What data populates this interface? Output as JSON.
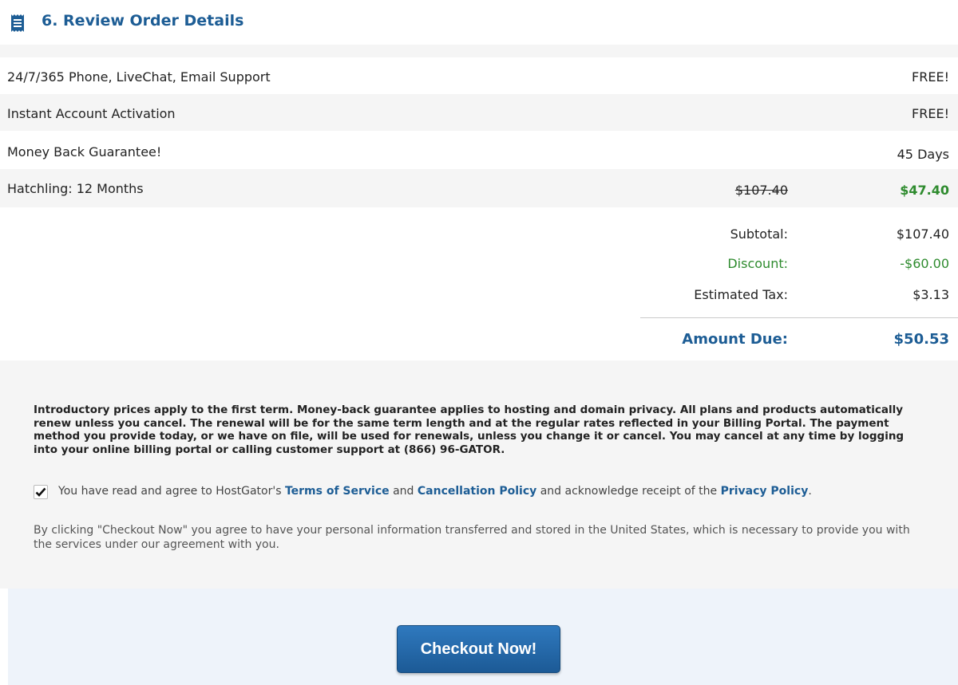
{
  "header": {
    "title": "6. Review Order Details",
    "icon": "receipt-icon"
  },
  "order_items": [
    {
      "label": "24/7/365 Phone, LiveChat, Email Support",
      "value": "FREE!"
    },
    {
      "label": "Instant Account Activation",
      "value": "FREE!"
    },
    {
      "label": "Money Back Guarantee!",
      "value": "45 Days"
    },
    {
      "label": "Hatchling: 12 Months",
      "original_price": "$107.40",
      "value": "$47.40"
    }
  ],
  "totals": {
    "subtotal_label": "Subtotal:",
    "subtotal_value": "$107.40",
    "discount_label": "Discount:",
    "discount_value": "-$60.00",
    "tax_label": "Estimated Tax:",
    "tax_value": "$3.13",
    "amount_due_label": "Amount Due:",
    "amount_due_value": "$50.53"
  },
  "legal": {
    "intro": "Introductory prices apply to the first term. Money-back guarantee applies to hosting and domain privacy. All plans and products automatically renew unless you cancel. The renewal will be for the same term length and at the regular rates reflected in your Billing Portal. The payment method you provide today, or we have on file, will be used for renewals, unless you change it or cancel. You may cancel at any time by logging into your online billing portal or calling customer support at (866) 96-GATOR.",
    "agree_prefix": "You have read and agree to HostGator's ",
    "terms_link": "Terms of Service",
    "and_text": " and ",
    "cancellation_link": "Cancellation Policy",
    "ack_text": " and acknowledge receipt of the ",
    "privacy_link": "Privacy Policy",
    "period": ".",
    "agree_checked": true,
    "transfer": "By clicking \"Checkout Now\" you agree to have your personal information transferred and stored in the United States, which is necessary to provide you with the services under our agreement with you."
  },
  "checkout": {
    "button_label": "Checkout Now!"
  },
  "colors": {
    "brand_blue": "#1d5d95",
    "discount_green": "#2e8b2e",
    "row_alt": "#f5f5f5"
  }
}
